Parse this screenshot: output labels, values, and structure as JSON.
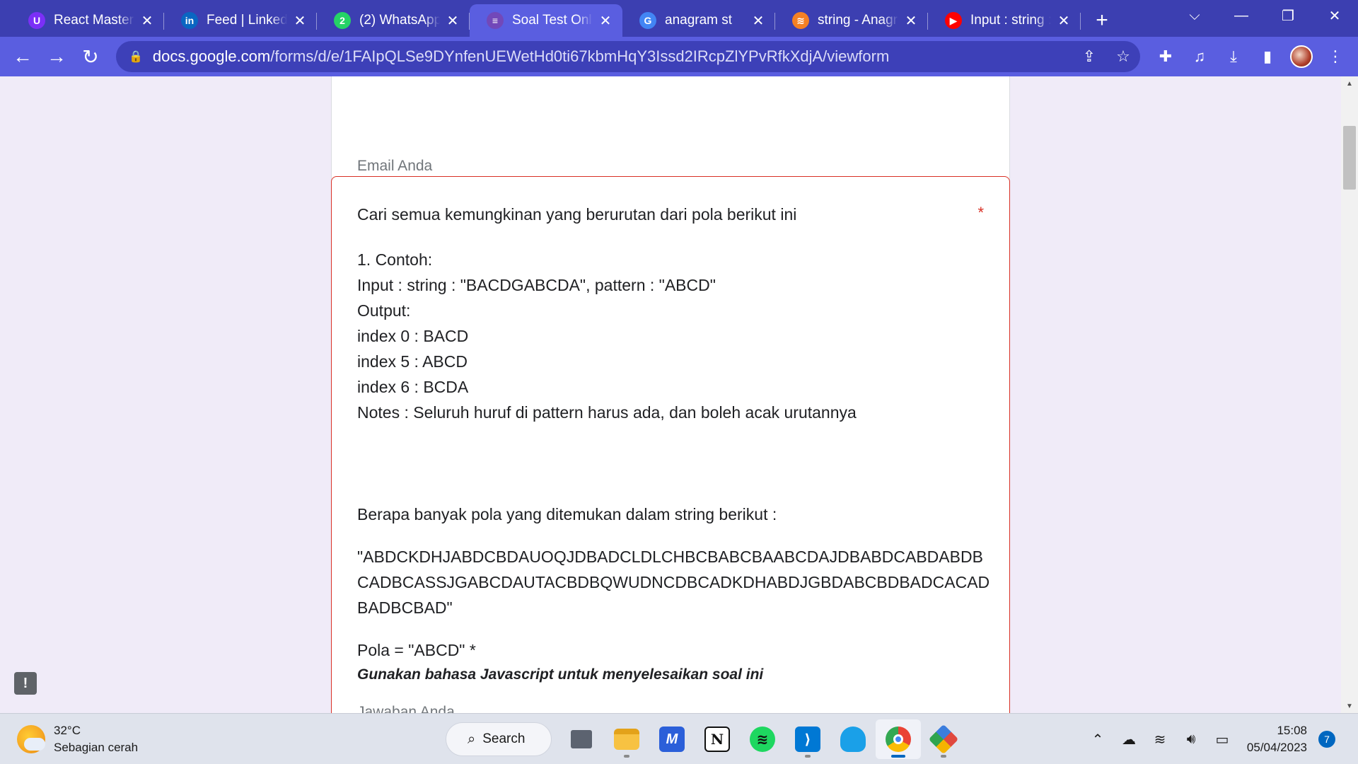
{
  "tabs": [
    {
      "title": "React Mastercla",
      "favicon": "u-circle-icon",
      "favicon_color": "#7b2ff7",
      "favicon_glyph": "U",
      "active": false
    },
    {
      "title": "Feed | LinkedIn",
      "favicon": "linkedin-icon",
      "favicon_color": "#0a66c2",
      "favicon_glyph": "in",
      "active": false
    },
    {
      "title": "(2) WhatsApp",
      "favicon": "whatsapp-icon",
      "favicon_color": "#25d366",
      "favicon_glyph": "2",
      "active": false
    },
    {
      "title": "Soal Test Onlin",
      "favicon": "google-forms-icon",
      "favicon_color": "#7248b9",
      "favicon_glyph": "≡",
      "active": true
    },
    {
      "title": "anagram st",
      "favicon": "google-icon",
      "favicon_color": "#4285f4",
      "favicon_glyph": "G",
      "active": false
    },
    {
      "title": "string - Anagra",
      "favicon": "stackoverflow-icon",
      "favicon_color": "#f48024",
      "favicon_glyph": "≋",
      "active": false
    },
    {
      "title": "Input : string :",
      "favicon": "youtube-icon",
      "favicon_color": "#ff0000",
      "favicon_glyph": "▶",
      "active": false
    }
  ],
  "browser": {
    "url_host": "docs.google.com",
    "url_path": "/forms/d/e/1FAIpQLSe9DYnfenUEWetHd0ti67kbmHqY3Issd2IRcpZlYPvRfkXdjA/viewform",
    "new_tab_label": "+"
  },
  "form": {
    "email_placeholder": "Email Anda",
    "question_title": "Cari semua kemungkinan yang berurutan dari pola berikut ini",
    "required_marker": "*",
    "example_lines": [
      "1. Contoh:",
      "Input : string : \"BACDGABCDA\", pattern : \"ABCD\"",
      "Output:",
      "index 0 : BACD",
      "index 5 : ABCD",
      "index 6 : BCDA",
      "Notes : Seluruh huruf di pattern harus ada, dan boleh acak urutannya"
    ],
    "question_prompt": "Berapa banyak pola yang ditemukan dalam string berikut :",
    "sequence_lines": [
      "\"ABDCKDHJABDCBDAUOQJDBADCLDLCHBCBABCBAABCDAJDBABDCABDABDB",
      "CADBCASSJGABCDAUTACBDBQWUDNCDBCADKDHABDJGBDABCBDBADCACAD",
      "BADBCBAD\""
    ],
    "pattern_line": "Pola = \"ABCD\" *",
    "hint": "Gunakan bahasa Javascript untuk menyelesaikan soal ini",
    "answer_placeholder": "Jawaban Anda"
  },
  "taskbar": {
    "temperature": "32°C",
    "weather": "Sebagian cerah",
    "search_label": "Search",
    "time": "15:08",
    "date": "05/04/2023",
    "notification_count": "7"
  }
}
